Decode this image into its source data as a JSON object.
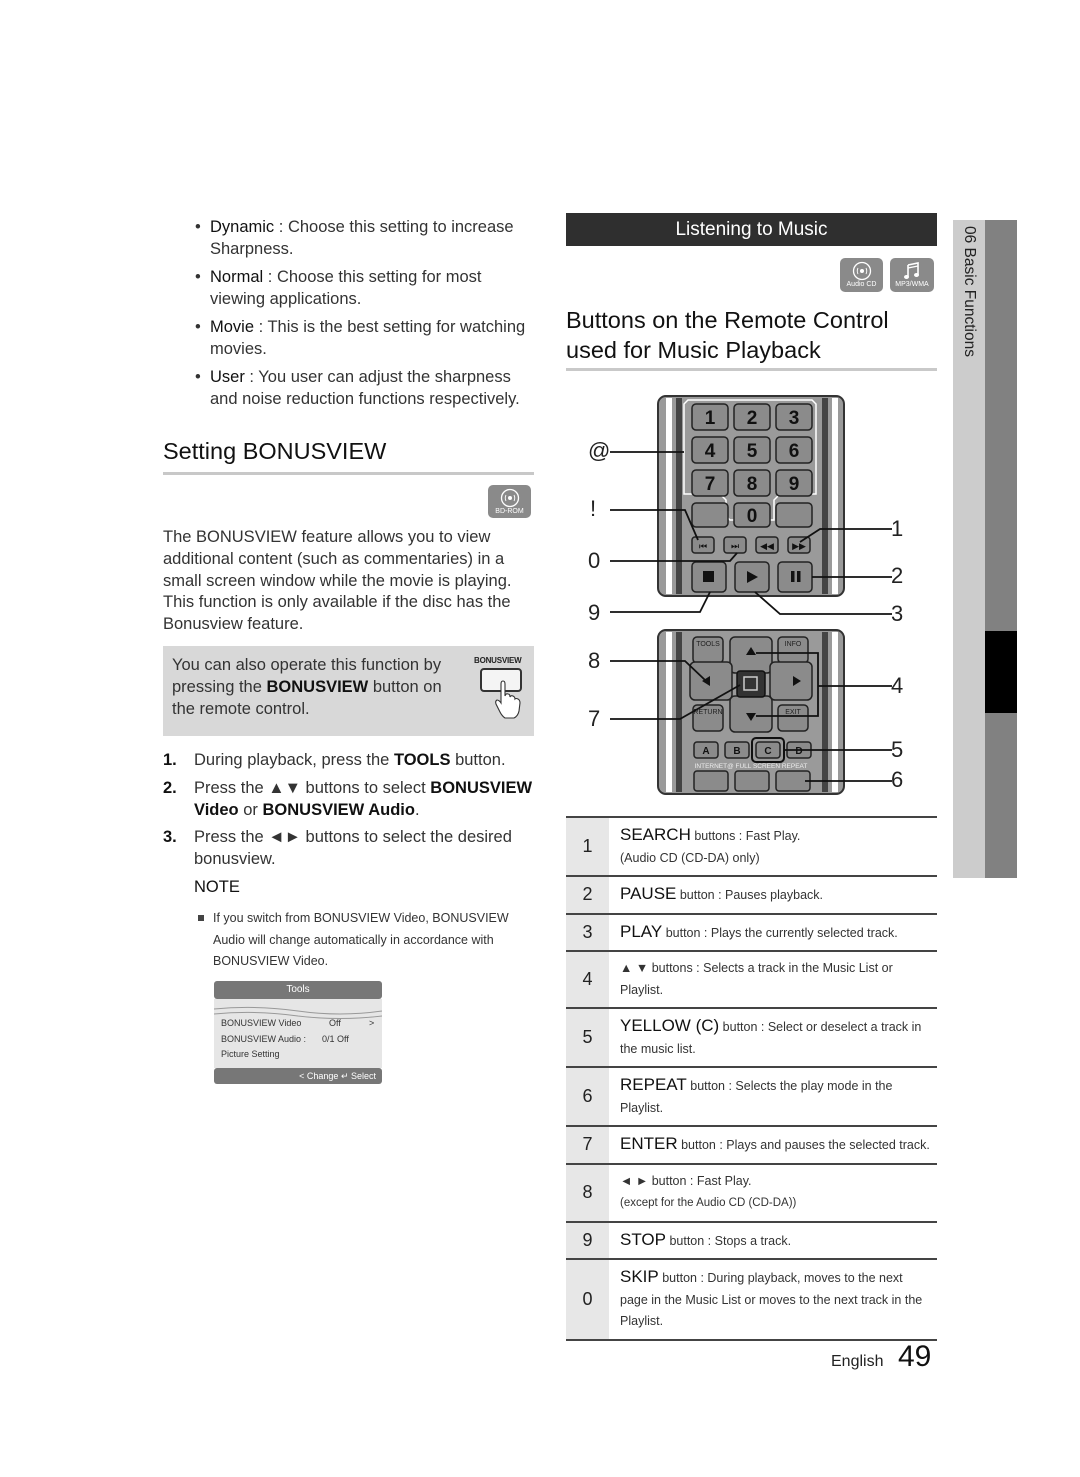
{
  "picture_modes": [
    {
      "term": "Dynamic",
      "desc": " : Choose this setting to increase Sharpness."
    },
    {
      "term": "Normal",
      "desc": " : Choose this setting for most viewing applications."
    },
    {
      "term": "Movie",
      "desc": " : This is the best setting for watching movies."
    },
    {
      "term": "User",
      "desc": " : You user can adjust the sharpness and noise reduction functions respectively."
    }
  ],
  "bonusview": {
    "heading": "Setting BONUSVIEW",
    "disc_badge": "BD-ROM",
    "intro": "The BONUSVIEW feature allows you to view additional content (such as commentaries) in a small screen window while the movie is playing. This function is only available if the disc has the Bonusview feature.",
    "tip_pre": "You can also operate this function by pressing the ",
    "tip_bold": "BONUSVIEW",
    "tip_post": " button on the remote control.",
    "tip_button_label": "BONUSVIEW",
    "steps": [
      {
        "num": "1.",
        "pre": "During playback, press the ",
        "b1": "TOOLS",
        "mid": " button.",
        "b2": "",
        "mid2": "",
        "b3": "",
        "post": ""
      },
      {
        "num": "2.",
        "pre": "Press the ▲▼ buttons to select ",
        "b1": "BONUSVIEW Video",
        "mid": " or ",
        "b2": "BONUSVIEW Audio",
        "mid2": ".",
        "b3": "",
        "post": ""
      },
      {
        "num": "3.",
        "pre": "Press the ◄► buttons to select the desired bonusview.",
        "b1": "",
        "mid": "",
        "b2": "",
        "mid2": "",
        "b3": "",
        "post": ""
      }
    ],
    "note_heading": "NOTE",
    "note_text": "If you switch from BONUSVIEW Video, BONUSVIEW Audio will change automatically in accordance with BONUSVIEW Video.",
    "tools_menu": {
      "title": "Tools",
      "rows": [
        {
          "label": "BONUSVIEW Video",
          "value": "Off",
          "arrow": ">"
        },
        {
          "label": "BONUSVIEW Audio :",
          "value": "0/1 Off",
          "arrow": ""
        },
        {
          "label": "Picture Setting",
          "value": "",
          "arrow": ""
        }
      ],
      "footer": "< Change  ↵ Select"
    }
  },
  "music": {
    "section_bar": "Listening to Music",
    "badges": [
      "Audio CD",
      "MP3/WMA"
    ],
    "heading": "Buttons on the Remote Control used for Music Playback",
    "remote": {
      "number_keys": [
        "1",
        "2",
        "3",
        "4",
        "5",
        "6",
        "7",
        "8",
        "9",
        "0"
      ],
      "tools_label": "TOOLS",
      "info_label": "INFO",
      "return_label": "RETURN",
      "exit_label": "EXIT",
      "color_keys": [
        "A",
        "B",
        "C",
        "D"
      ],
      "bottom_labels": "INTERNET@  FULL SCREEN  REPEAT"
    },
    "callouts_left": [
      "@",
      "!",
      "0",
      "9",
      "8",
      "7"
    ],
    "callouts_right": [
      "1",
      "2",
      "3",
      "4",
      "5",
      "6"
    ],
    "table": [
      {
        "n": "1",
        "big": "SEARCH",
        "text": " buttons : Fast Play.",
        "line2": "(Audio CD (CD-DA) only)"
      },
      {
        "n": "2",
        "big": "PAUSE",
        "text": " button : Pauses playback.",
        "line2": ""
      },
      {
        "n": "3",
        "big": "PLAY",
        "text": " button : Plays the currently selected track.",
        "line2": ""
      },
      {
        "n": "4",
        "big": "",
        "text": "▲ ▼  buttons : Selects a track in the Music List or Playlist.",
        "line2": ""
      },
      {
        "n": "5",
        "big": "YELLOW (C)",
        "text": " button : Select or deselect a track in the music list.",
        "line2": ""
      },
      {
        "n": "6",
        "big": "REPEAT",
        "text": " button : Selects the play mode in the Playlist.",
        "line2": ""
      },
      {
        "n": "7",
        "big": "ENTER",
        "text": " button : Plays and pauses the selected track.",
        "line2": ""
      },
      {
        "n": "8",
        "big": "",
        "text": "◄  ►  button : Fast Play.",
        "line2": "(except for the Audio CD (CD-DA))"
      },
      {
        "n": "9",
        "big": "STOP",
        "text": " button : Stops a track.",
        "line2": ""
      },
      {
        "n": "0",
        "big": "SKIP",
        "text": " button : During playback, moves to the next page in the Music List or moves to the next track in the Playlist.",
        "line2": ""
      }
    ]
  },
  "sidebar": {
    "chapter": "06  Basic Functions"
  },
  "footer": {
    "language": "English",
    "page": "49"
  }
}
